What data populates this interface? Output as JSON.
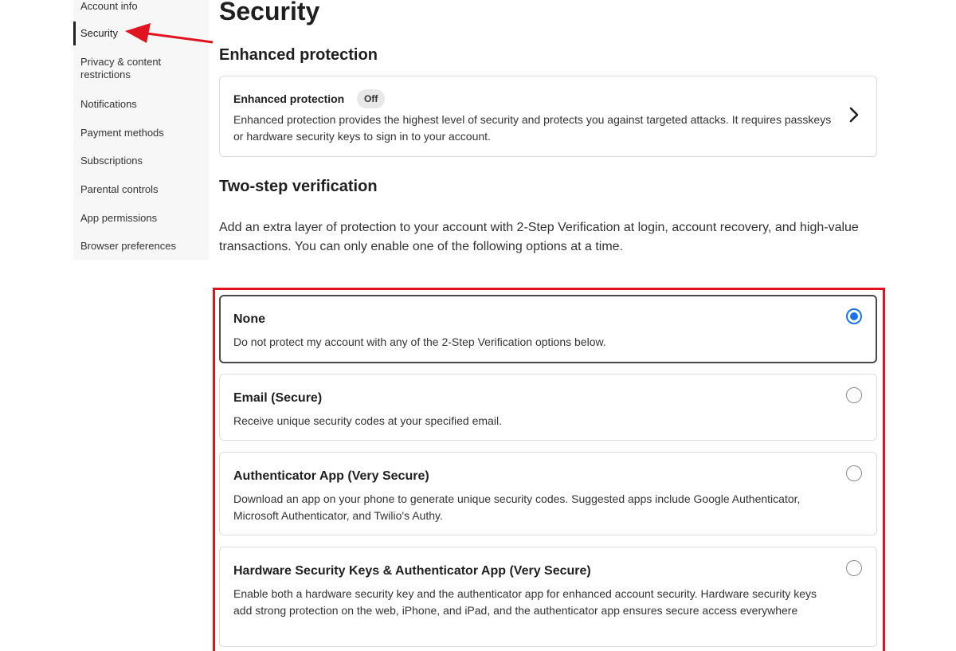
{
  "sidebar": {
    "items": [
      {
        "label": "Account info",
        "active": false
      },
      {
        "label": "Security",
        "active": true
      },
      {
        "label": "Privacy & content restrictions",
        "active": false
      },
      {
        "label": "Notifications",
        "active": false
      },
      {
        "label": "Payment methods",
        "active": false
      },
      {
        "label": "Subscriptions",
        "active": false
      },
      {
        "label": "Parental controls",
        "active": false
      },
      {
        "label": "App permissions",
        "active": false
      },
      {
        "label": "Browser preferences",
        "active": false
      }
    ]
  },
  "main": {
    "title": "Security",
    "enhanced": {
      "heading": "Enhanced protection",
      "card_title": "Enhanced protection",
      "status": "Off",
      "description": "Enhanced protection provides the highest level of security and protects you against targeted attacks. It requires passkeys or hardware security keys to sign in to your account."
    },
    "two_step": {
      "heading": "Two-step verification",
      "intro": "Add an extra layer of protection to your account with 2-Step Verification at login, account recovery, and high-value transactions. You can only enable one of the following options at a time.",
      "options": [
        {
          "title": "None",
          "description": "Do not protect my account with any of the 2-Step Verification options below.",
          "selected": true
        },
        {
          "title": "Email (Secure)",
          "description": "Receive unique security codes at your specified email.",
          "selected": false
        },
        {
          "title": "Authenticator App (Very Secure)",
          "description": "Download an app on your phone to generate unique security codes. Suggested apps include Google Authenticator, Microsoft Authenticator, and Twilio's Authy.",
          "selected": false
        },
        {
          "title": "Hardware Security Keys & Authenticator App (Very Secure)",
          "description": "Enable both a hardware security key and the authenticator app for enhanced account security. Hardware security keys add strong protection on the web, iPhone, and iPad, and the authenticator app ensures secure access everywhere",
          "selected": false
        }
      ]
    }
  },
  "colors": {
    "annotation_red": "#e0141e",
    "radio_selected": "#1a73e8"
  }
}
